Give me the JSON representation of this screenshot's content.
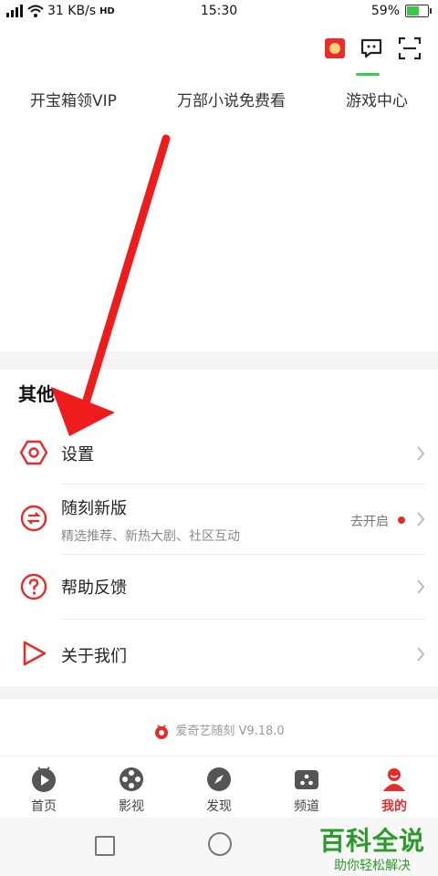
{
  "status_bar": {
    "network": "31 KB/s",
    "hd": "HD",
    "time": "15:30",
    "battery": "59%",
    "battery_level": 0.59
  },
  "quick_links": [
    "开宝箱领VIP",
    "万部小说免费看",
    "游戏中心"
  ],
  "section": {
    "title": "其他",
    "items": [
      {
        "label": "设置",
        "icon": "settings-icon"
      },
      {
        "label": "随刻新版",
        "sub": "精选推荐、新热大剧、社区互动",
        "hint": "去开启",
        "icon": "swap-icon"
      },
      {
        "label": "帮助反馈",
        "icon": "help-icon"
      },
      {
        "label": "关于我们",
        "icon": "play-outline-icon"
      }
    ]
  },
  "version": "爱奇艺随刻 V9.18.0",
  "tabs": [
    {
      "label": "首页",
      "icon": "home-icon"
    },
    {
      "label": "影视",
      "icon": "film-reel-icon"
    },
    {
      "label": "发现",
      "icon": "compass-icon"
    },
    {
      "label": "频道",
      "icon": "channel-icon"
    },
    {
      "label": "我的",
      "icon": "profile-icon",
      "active": true
    }
  ],
  "watermark": {
    "title": "百科全说",
    "subtitle": "助你轻松解决"
  },
  "colors": {
    "accent": "#e62b2b",
    "watermark": "#2b9a2b"
  }
}
